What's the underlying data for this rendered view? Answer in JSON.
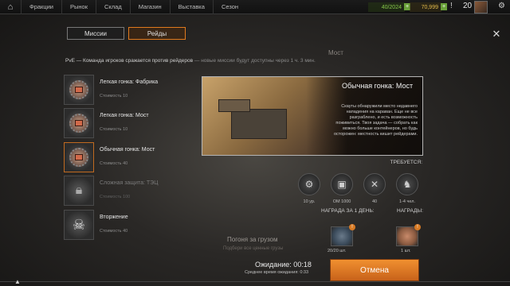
{
  "topbar": {
    "nav": [
      "Фракции",
      "Рынок",
      "Склад",
      "Магазин",
      "Выставка",
      "Сезон"
    ],
    "resource1": "40/2024",
    "resource2": "70,999",
    "level": "20"
  },
  "tabs": [
    {
      "label": "Миссии",
      "active": false
    },
    {
      "label": "Рейды",
      "active": true
    }
  ],
  "header_ghost": "Мост",
  "description": {
    "main": "PvE — Команда игроков сражается против рейдеров",
    "note": " — новые миссии будут доступны через 1 ч. 3 мин."
  },
  "missions": [
    {
      "name": "Легкая гонка: Фабрика",
      "cost": "Стоимость 10",
      "locked": false,
      "selected": false
    },
    {
      "name": "Легкая гонка: Мост",
      "cost": "Стоимость 10",
      "locked": false,
      "selected": false
    },
    {
      "name": "Обычная гонка: Мост",
      "cost": "Стоимость 40",
      "locked": false,
      "selected": true
    },
    {
      "name": "Сложная защита: ТЭЦ",
      "cost": "Стоимость 100",
      "locked": true,
      "selected": false
    },
    {
      "name": "Вторжение",
      "cost": "Стоимость 40",
      "locked": false,
      "selected": false
    }
  ],
  "detail": {
    "title": "Обычная гонка: Мост",
    "text": "Скауты обнаружили место недавнего нападения на караван. Еще не все разграблено, и есть возможность поживиться. Твоя задача — собрать как можно больше контейнеров, но будь осторожен: местность кишит рейдерами."
  },
  "requirements": {
    "label": "ТРЕБУЕТСЯ:",
    "items": [
      {
        "icon": "gear-icon",
        "value": "10 ур."
      },
      {
        "icon": "armor-icon",
        "value": "ОМ 1000"
      },
      {
        "icon": "wrench-icon",
        "value": "40"
      },
      {
        "icon": "crew-icon",
        "value": "1-4 чел."
      }
    ]
  },
  "rewards": {
    "daily_label": "НАГРАДА ЗА 1 ДЕНЬ:",
    "label": "НАГРАДЫ:",
    "daily_count": "20/20 шт.",
    "count": "1 шт."
  },
  "convoy": {
    "title": "Погоня за грузом",
    "subtitle": "Подбери все ценные грузы"
  },
  "waiting": "Ожидание: 00:18",
  "avg_waiting": "Среднее время ожидания: 0:33",
  "cancel_label": "Отмена"
}
